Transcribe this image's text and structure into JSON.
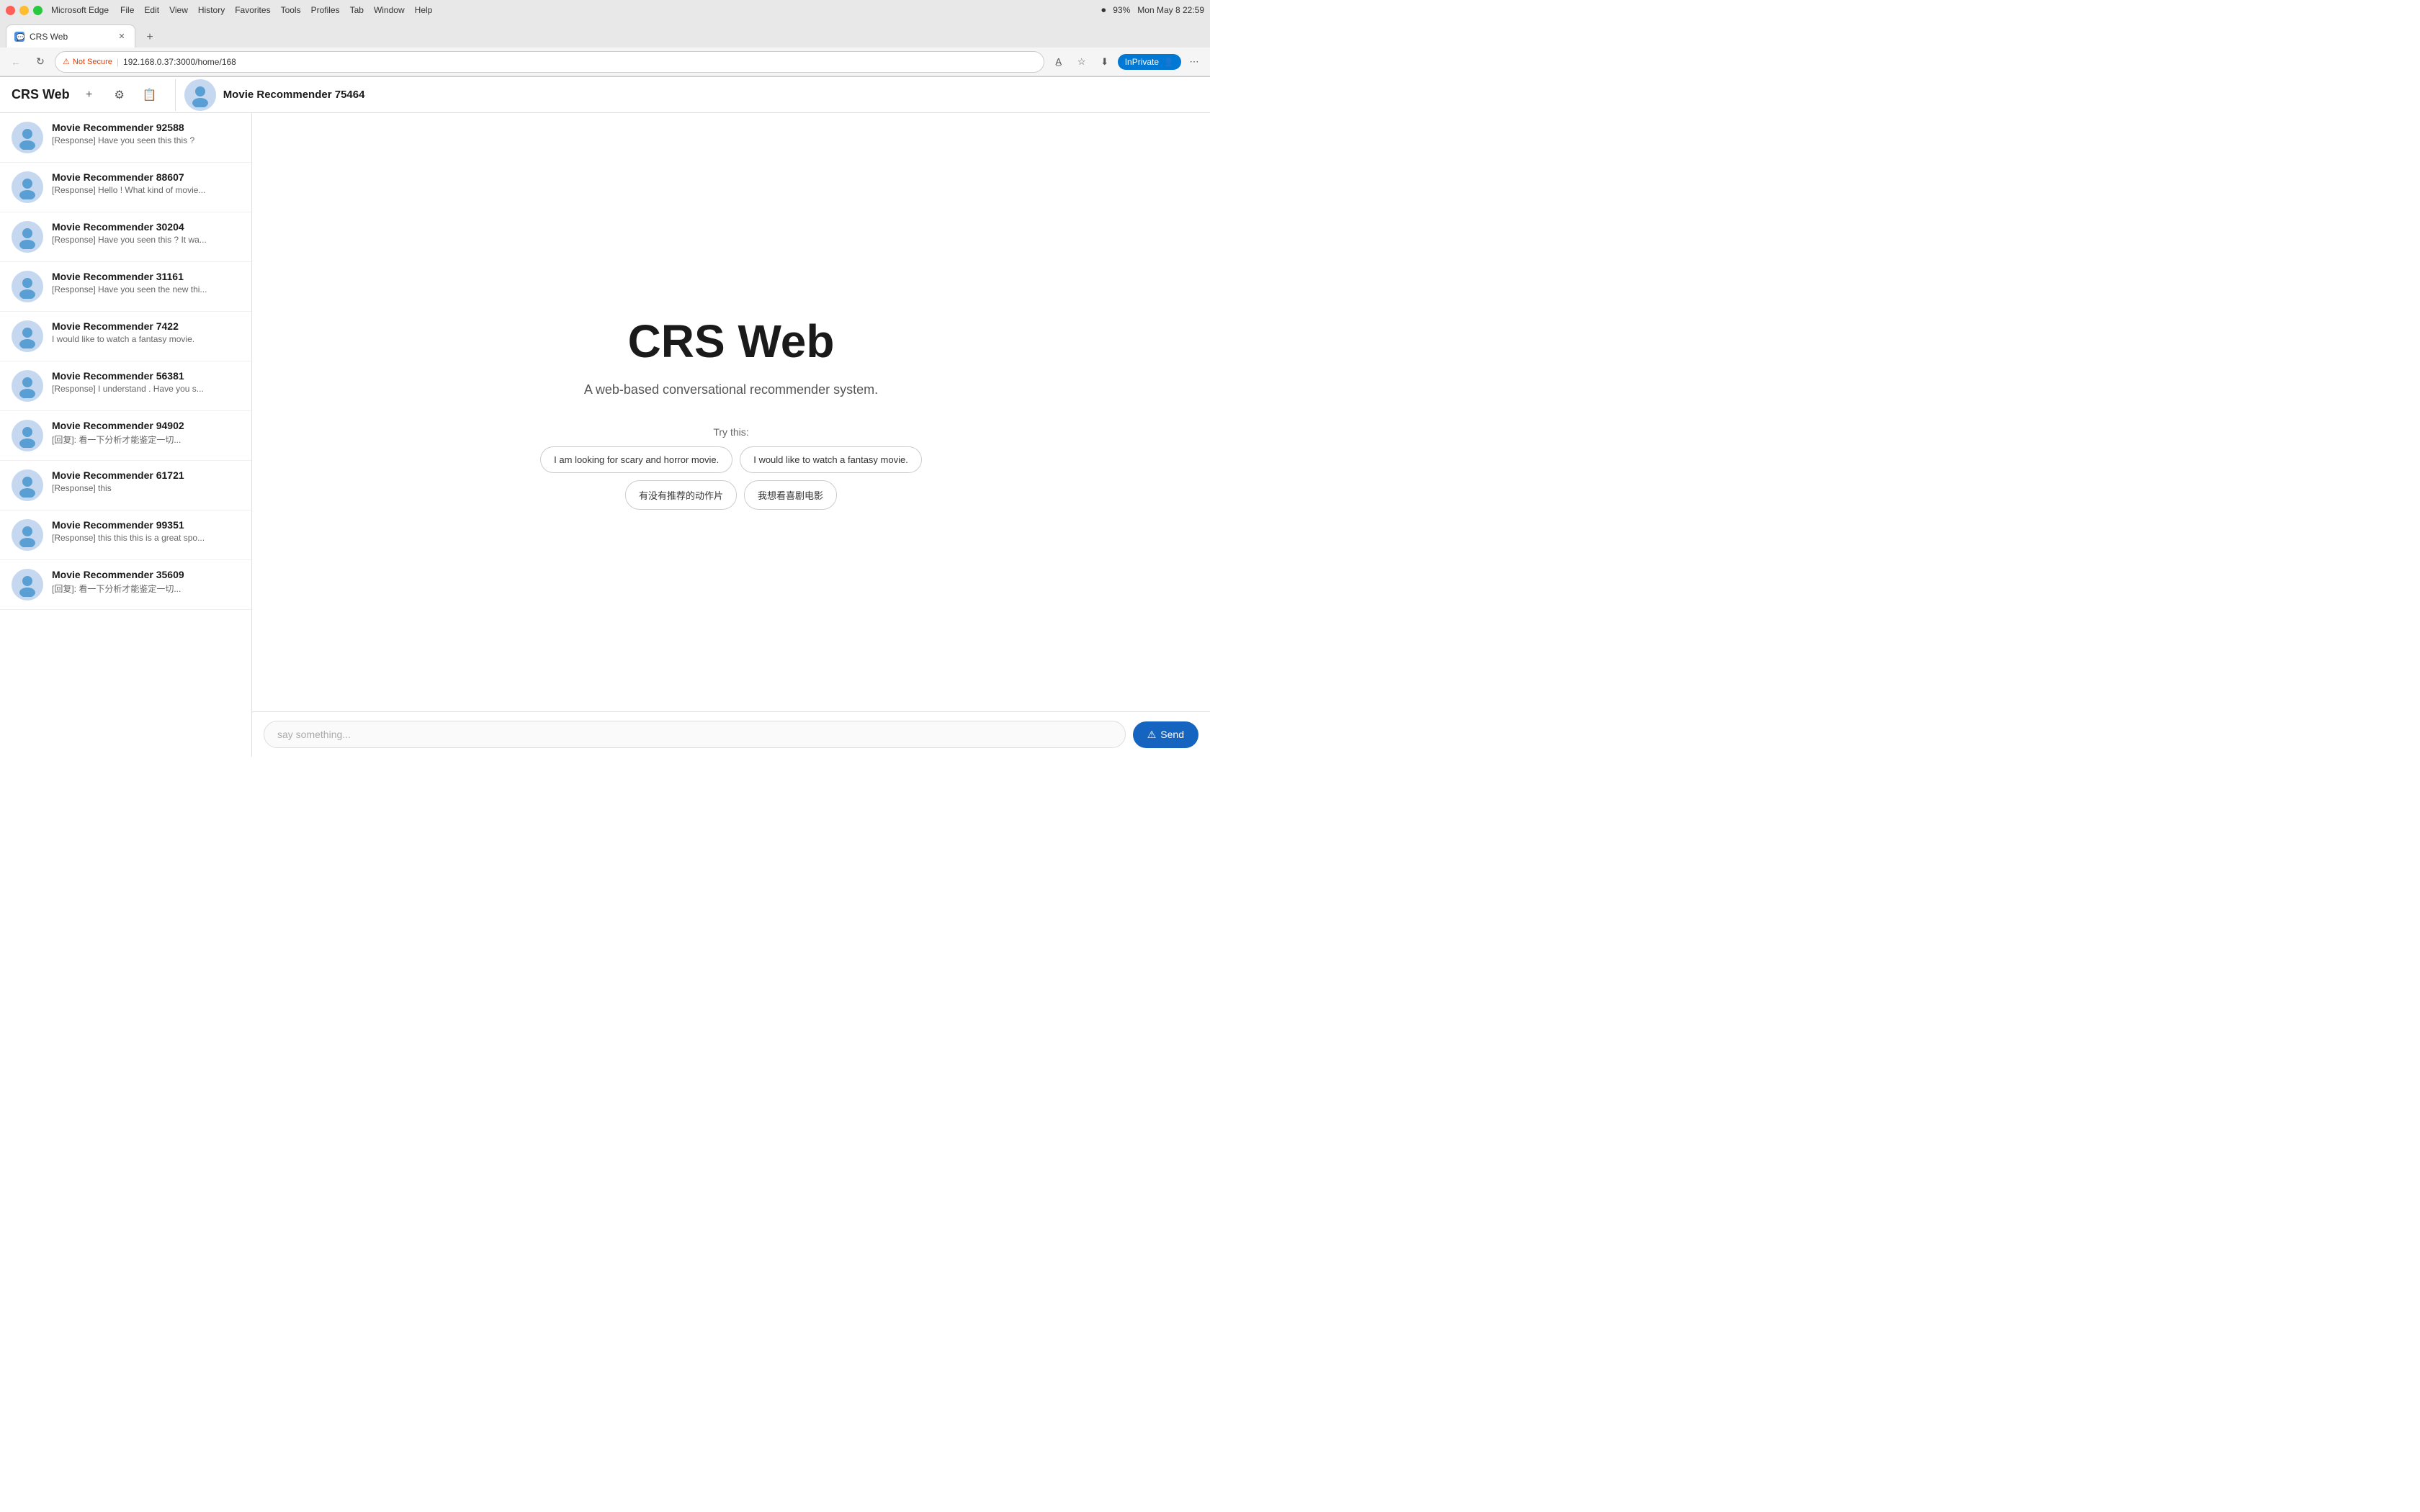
{
  "os": {
    "app": "Microsoft Edge",
    "menu_items": [
      "File",
      "Edit",
      "View",
      "History",
      "Favorites",
      "Tools",
      "Profiles",
      "Tab",
      "Window",
      "Help"
    ],
    "time": "Mon May 8  22:59",
    "battery": "93%"
  },
  "browser": {
    "tab_title": "CRS Web",
    "tab_icon": "💬",
    "address": "192.168.0.37:3000/home/168",
    "security_label": "Not Secure",
    "inprivate_label": "InPrivate"
  },
  "app": {
    "title": "CRS Web",
    "current_chat": "Movie Recommender 75464",
    "input_placeholder": "say something...",
    "send_label": "Send"
  },
  "main": {
    "heading": "CRS Web",
    "subtitle": "A web-based conversational recommender system.",
    "try_label": "Try this:",
    "suggestions": [
      "I am looking for scary and horror movie.",
      "I would like to watch a fantasy movie.",
      "有没有推荐的动作片",
      "我想看喜剧电影"
    ]
  },
  "sidebar": {
    "chats": [
      {
        "name": "Movie Recommender 92588",
        "preview": "[Response] Have you seen this this ?"
      },
      {
        "name": "Movie Recommender 88607",
        "preview": "[Response] Hello ! What kind of movie..."
      },
      {
        "name": "Movie Recommender 30204",
        "preview": "[Response] Have you seen this ? It wa..."
      },
      {
        "name": "Movie Recommender 31161",
        "preview": "[Response] Have you seen the new thi..."
      },
      {
        "name": "Movie Recommender 7422",
        "preview": "I would like to watch a fantasy movie."
      },
      {
        "name": "Movie Recommender 56381",
        "preview": "[Response] I understand . Have you s..."
      },
      {
        "name": "Movie Recommender 94902",
        "preview": "[回复]: 看一下分析才能鉴定一切..."
      },
      {
        "name": "Movie Recommender 61721",
        "preview": "[Response] this"
      },
      {
        "name": "Movie Recommender 99351",
        "preview": "[Response] this this this is a great spo..."
      },
      {
        "name": "Movie Recommender 35609",
        "preview": "[回复]: 看一下分析才能鉴定一切..."
      }
    ]
  }
}
